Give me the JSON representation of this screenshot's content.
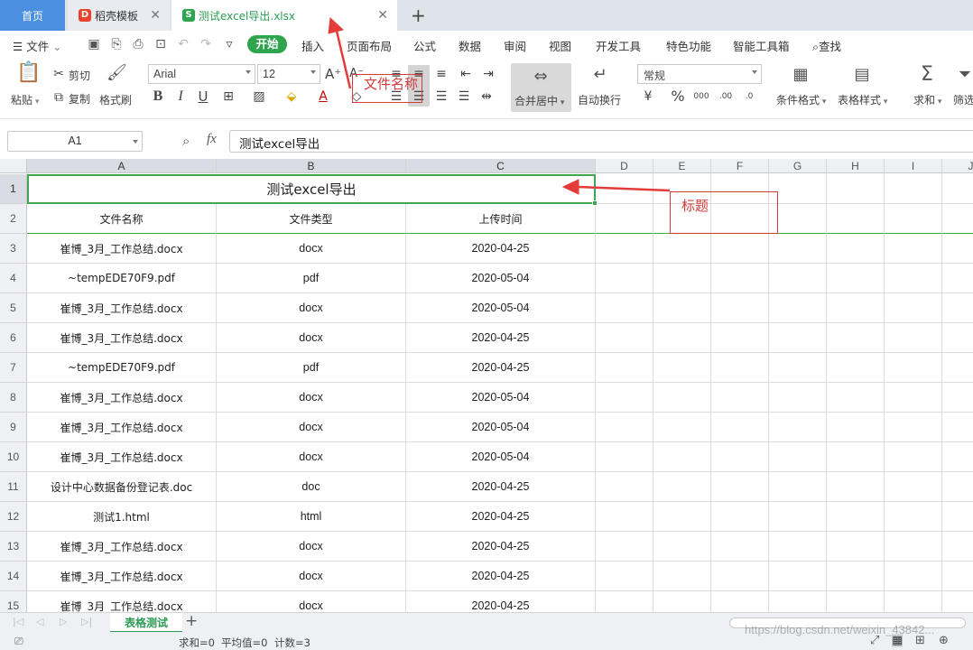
{
  "tabs": {
    "home": "首页",
    "template": "稻壳模板",
    "file": "测试excel导出.xlsx"
  },
  "menu": {
    "file": "文件",
    "start": "开始",
    "insert": "插入",
    "page_layout": "页面布局",
    "formula": "公式",
    "data": "数据",
    "review": "审阅",
    "view": "视图",
    "dev_tools": "开发工具",
    "special": "特色功能",
    "smart_toolbox": "智能工具箱",
    "find": "查找"
  },
  "ribbon": {
    "paste": "粘贴",
    "cut": "剪切",
    "copy": "复制",
    "format_painter": "格式刷",
    "font_name": "Arial",
    "font_size": "12",
    "merge_center": "合并居中",
    "wrap_text": "自动换行",
    "number_format": "常规",
    "cond_format": "条件格式",
    "table_style": "表格样式",
    "sum": "求和",
    "filter": "筛选"
  },
  "formula_bar": {
    "cell_ref": "A1",
    "fx": "fx",
    "content": "测试excel导出"
  },
  "columns": [
    "A",
    "B",
    "C",
    "D",
    "E",
    "F",
    "G",
    "H",
    "I",
    "J"
  ],
  "sheet": {
    "title": "测试excel导出",
    "headers": [
      "文件名称",
      "文件类型",
      "上传时间"
    ],
    "rows": [
      [
        "崔博_3月_工作总结.docx",
        "docx",
        "2020-04-25"
      ],
      [
        "~tempEDE70F9.pdf",
        "pdf",
        "2020-05-04"
      ],
      [
        "崔博_3月_工作总结.docx",
        "docx",
        "2020-05-04"
      ],
      [
        "崔博_3月_工作总结.docx",
        "docx",
        "2020-04-25"
      ],
      [
        "~tempEDE70F9.pdf",
        "pdf",
        "2020-04-25"
      ],
      [
        "崔博_3月_工作总结.docx",
        "docx",
        "2020-05-04"
      ],
      [
        "崔博_3月_工作总结.docx",
        "docx",
        "2020-05-04"
      ],
      [
        "崔博_3月_工作总结.docx",
        "docx",
        "2020-05-04"
      ],
      [
        "设计中心数据备份登记表.doc",
        "doc",
        "2020-04-25"
      ],
      [
        "测试1.html",
        "html",
        "2020-04-25"
      ],
      [
        "崔博_3月_工作总结.docx",
        "docx",
        "2020-04-25"
      ],
      [
        "崔博_3月_工作总结.docx",
        "docx",
        "2020-04-25"
      ],
      [
        "崔博_3月_工作总结.docx",
        "docx",
        "2020-04-25"
      ]
    ]
  },
  "sheet_tab": "表格测试",
  "status": {
    "sum": "求和=0",
    "avg": "平均值=0",
    "count": "计数=3"
  },
  "annotations": {
    "filename_label": "文件名称",
    "title_label": "标题"
  },
  "watermark": "https://blog.csdn.net/weixin_43842...",
  "colors": {
    "accent_green": "#2ea44f",
    "home_tab": "#4a8fe0",
    "annotation_red": "#d23c3c"
  }
}
